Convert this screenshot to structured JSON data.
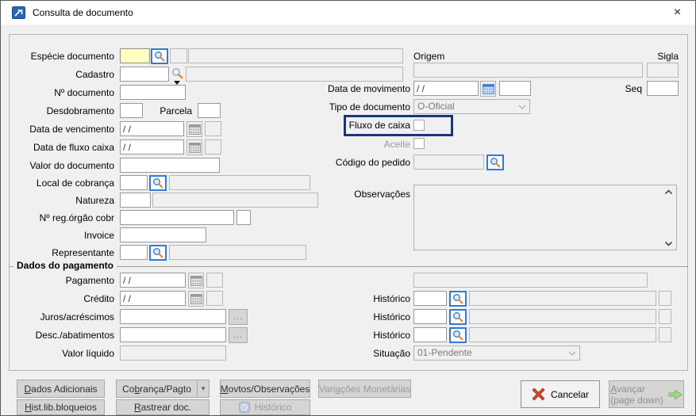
{
  "window": {
    "title": "Consulta de documento",
    "close_glyph": "×"
  },
  "labels": {
    "especie_documento": "Espécie documento",
    "cadastro": "Cadastro",
    "num_documento": "Nº documento",
    "desdobramento": "Desdobramento",
    "parcela": "Parcela",
    "data_vencimento": "Data de vencimento",
    "data_fluxo_caixa": "Data de fluxo caixa",
    "valor_documento": "Valor do documento",
    "local_cobranca": "Local de cobrança",
    "natureza": "Natureza",
    "num_reg_orgao_cobr": "Nº reg.órgão cobr",
    "invoice": "Invoice",
    "representante": "Representante",
    "origem": "Origem",
    "sigla": "Sigla",
    "data_movimento": "Data de movimento",
    "seq": "Seq",
    "tipo_documento": "Tipo de documento",
    "fluxo_caixa": "Fluxo de caixa",
    "aceite": "Aceite",
    "codigo_pedido": "Código do pedido",
    "observacoes": "Observações",
    "pagamento": "Pagamento",
    "credito": "Crédito",
    "juros_acrescimos": "Juros/acréscimos",
    "desc_abatimentos": "Desc./abatimentos",
    "valor_liquido": "Valor líquido",
    "historico": "Histórico",
    "situacao": "Situação"
  },
  "section": {
    "dados_pagamento": "Dados do pagamento"
  },
  "values": {
    "date_empty": "/ /",
    "tipo_documento": "O-Oficial",
    "situacao": "01-Pendente"
  },
  "buttons": {
    "dados_adicionais": {
      "label": "Dados Adicionais",
      "accel": 0
    },
    "cobranca_pagto": {
      "label": "Cobrança/Pagto",
      "accel": 2
    },
    "movtos_observacoes": {
      "label": "Movtos/Observações",
      "accel": 0
    },
    "variacoes_monetarias": {
      "label": "Variações Monetárias",
      "accel": 4
    },
    "hist_lib_bloqueios": {
      "label": "Hist.lib.bloqueios",
      "accel": 0
    },
    "rastrear_doc": {
      "label": "Rastrear doc.",
      "accel": 0
    },
    "historico": {
      "label": "Histórico",
      "accel": -1
    },
    "cancelar": {
      "label": "Cancelar",
      "accel": -1
    },
    "avancar": {
      "label": "Avançar",
      "accel": 0,
      "sub": "(page down)"
    },
    "ellipsis": "...",
    "dropdown_arrow": "▾"
  },
  "colors": {
    "highlight_border": "#16377d",
    "focus_field": "#ffffc0",
    "lookup_border": "#2e7bd2",
    "cancel_x": "#d8472f",
    "advance_arrow": "#a5d98a"
  }
}
